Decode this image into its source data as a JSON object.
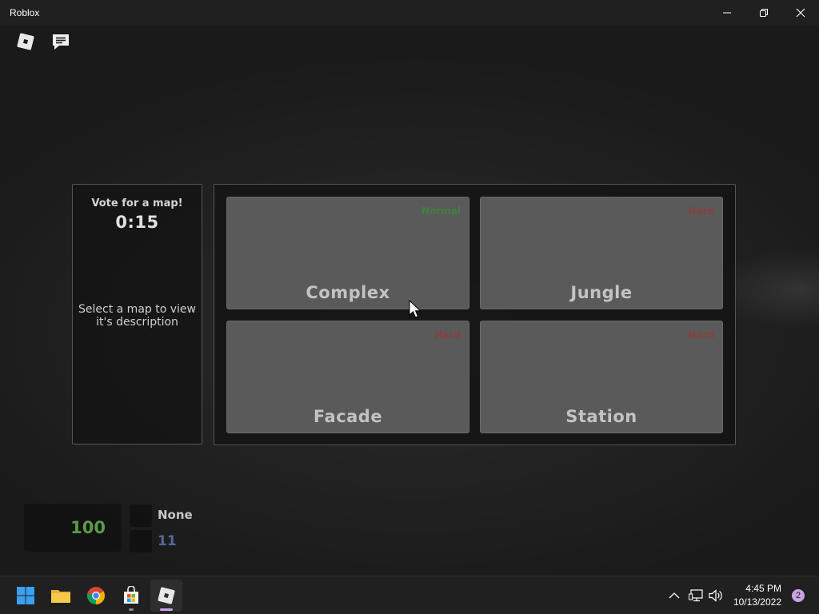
{
  "window": {
    "title": "Roblox"
  },
  "topbar": {
    "roblox_icon": "roblox-logo-icon",
    "chat_icon": "chat-icon"
  },
  "vote": {
    "title": "Vote for a map!",
    "timer": "0:15",
    "description": "Select a map to view it's description"
  },
  "maps": [
    {
      "name": "Complex",
      "difficulty": "Normal",
      "difficulty_color": "#2e9e2e"
    },
    {
      "name": "Jungle",
      "difficulty": "Hard",
      "difficulty_color": "#b02a2a"
    },
    {
      "name": "Facade",
      "difficulty": "Hard",
      "difficulty_color": "#b02a2a"
    },
    {
      "name": "Station",
      "difficulty": "Hard",
      "difficulty_color": "#b02a2a"
    }
  ],
  "hud": {
    "money": "100",
    "status": "None",
    "count": "11"
  },
  "taskbar": {
    "apps": [
      {
        "name": "start-icon"
      },
      {
        "name": "file-explorer-icon"
      },
      {
        "name": "chrome-icon"
      },
      {
        "name": "microsoft-store-icon"
      },
      {
        "name": "roblox-icon",
        "active": true
      }
    ],
    "time": "4:45 PM",
    "date": "10/13/2022",
    "notification_count": "2"
  },
  "colors": {
    "titlebar": "#202020",
    "taskbar": "#202020",
    "card": "#5a5a5a",
    "money": "#5c9a4a",
    "count": "#5567a0",
    "accent_roblox_indicator": "#c9a2e6"
  }
}
